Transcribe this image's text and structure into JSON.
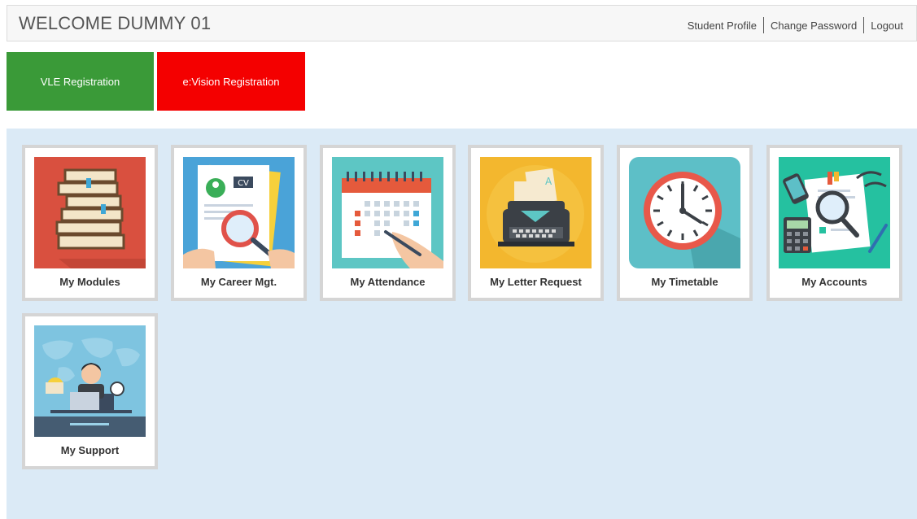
{
  "header": {
    "welcome": "WELCOME DUMMY 01",
    "links": {
      "profile": "Student Profile",
      "password": "Change Password",
      "logout": "Logout"
    }
  },
  "registration": {
    "vle": "VLE Registration",
    "evision": "e:Vision Registration"
  },
  "tiles": [
    {
      "label": "My Modules",
      "icon": "books-icon"
    },
    {
      "label": "My Career Mgt.",
      "icon": "cv-magnifier-icon"
    },
    {
      "label": "My Attendance",
      "icon": "calendar-icon"
    },
    {
      "label": "My Letter Request",
      "icon": "typewriter-icon"
    },
    {
      "label": "My Timetable",
      "icon": "clock-icon"
    },
    {
      "label": "My Accounts",
      "icon": "accounts-icon"
    },
    {
      "label": "My Support",
      "icon": "support-icon"
    }
  ],
  "colors": {
    "vle": "#3a9a38",
    "evision": "#f40000",
    "panel": "#dbeaf6"
  }
}
